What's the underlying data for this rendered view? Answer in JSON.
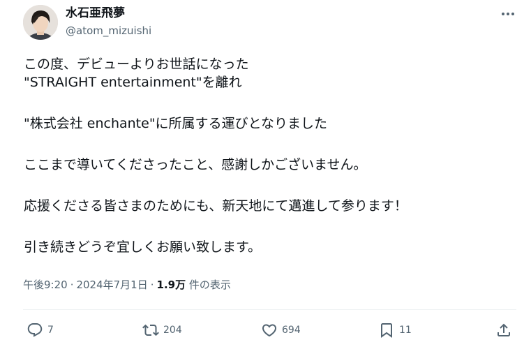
{
  "user": {
    "display_name": "水石亜飛夢",
    "handle": "@atom_mizuishi"
  },
  "tweet": {
    "lines": [
      "この度、デビューよりお世話になった",
      "\"STRAIGHT entertainment\"を離れ",
      "",
      "\"株式会社 enchante\"に所属する運びとなりました",
      "",
      "ここまで導いてくださったこと、感謝しかございません。",
      "",
      "応援くださる皆さまのためにも、新天地にて邁進して参ります！",
      "",
      "引き続きどうぞ宜しくお願い致します。"
    ]
  },
  "meta": {
    "time": "午後9:20",
    "separator": "·",
    "date": "2024年7月1日",
    "views_count": "1.9万",
    "views_label": "件の表示"
  },
  "actions": {
    "replies": "7",
    "retweets": "204",
    "likes": "694",
    "bookmarks": "11"
  },
  "icons": {
    "more": "more-icon",
    "reply": "reply-icon",
    "retweet": "retweet-icon",
    "like": "heart-icon",
    "bookmark": "bookmark-icon",
    "share": "share-icon"
  },
  "colors": {
    "text": "#0f1419",
    "secondary": "#536471",
    "divider": "#eff3f4"
  }
}
